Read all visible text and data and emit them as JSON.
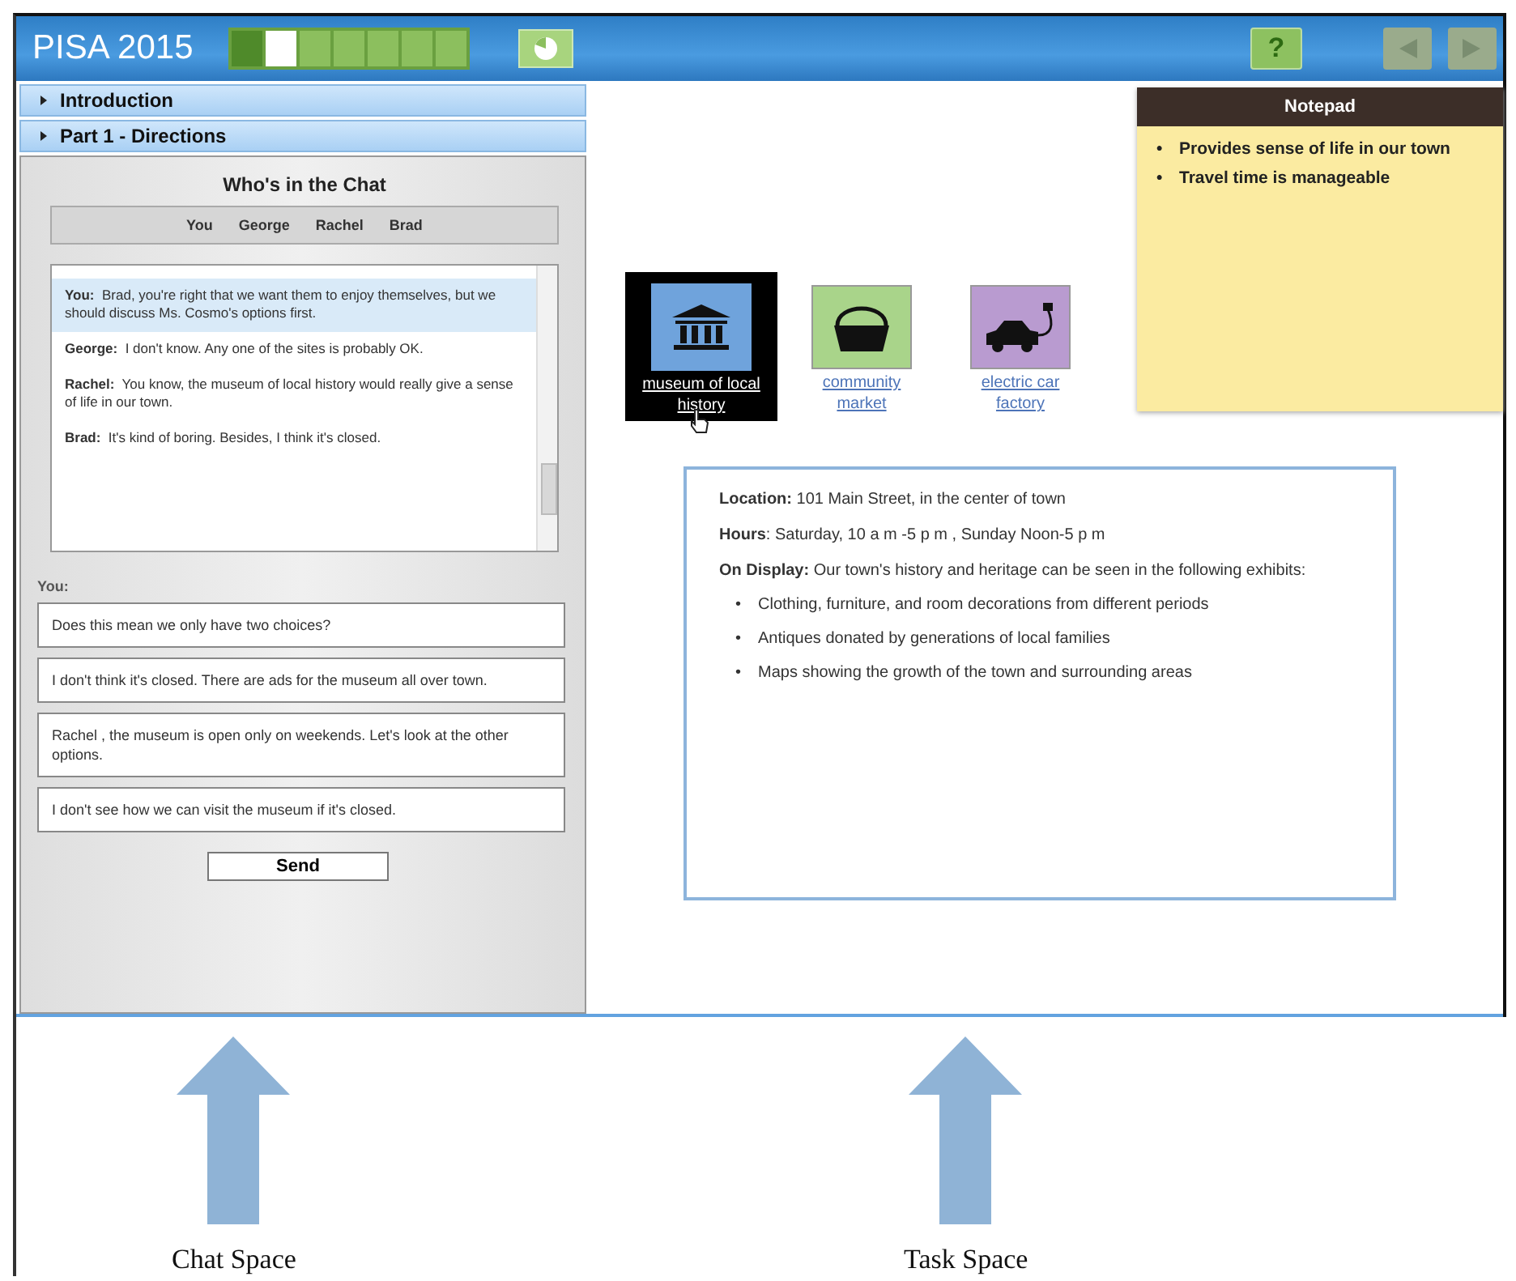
{
  "header": {
    "title": "PISA 2015",
    "progress": [
      {
        "kind": "done"
      },
      {
        "kind": "current"
      },
      {
        "kind": "todo"
      },
      {
        "kind": "todo"
      },
      {
        "kind": "todo"
      },
      {
        "kind": "todo"
      },
      {
        "kind": "todo"
      }
    ],
    "help_label": "?"
  },
  "sections": [
    {
      "label": "Introduction",
      "expanded": false
    },
    {
      "label": "Part 1 - Directions",
      "expanded": false
    }
  ],
  "chat": {
    "title": "Who's in the Chat",
    "participants": [
      "You",
      "George",
      "Rachel",
      "Brad"
    ],
    "messages": [
      {
        "speaker": "You:",
        "text": "Brad, you're right that we want them to enjoy themselves, but we should discuss Ms. Cosmo's options first.",
        "selected": true
      },
      {
        "speaker": "George:",
        "text": "I don't know. Any one of the sites is probably OK.",
        "selected": false
      },
      {
        "speaker": "Rachel:",
        "text": "You know, the museum of local history would really give a sense of life in our town.",
        "selected": false
      },
      {
        "speaker": "Brad:",
        "text": "It's kind of boring. Besides, I think it's closed.",
        "selected": false
      }
    ],
    "reply_label": "You:",
    "options": [
      "Does this mean we only have two choices?",
      "I don't think it's closed. There are ads for the museum all over town.",
      "Rachel , the museum is open only on weekends. Let's look at the other options.",
      "I don't see how we can visit the museum if it's closed."
    ],
    "send_label": "Send"
  },
  "sites": [
    {
      "kind": "museum",
      "label": "museum of local history",
      "selected": true
    },
    {
      "kind": "market",
      "label": "community market",
      "selected": false
    },
    {
      "kind": "car",
      "label": "electric car factory",
      "selected": false
    }
  ],
  "notepad": {
    "title": "Notepad",
    "bullet": "•",
    "items": [
      "Provides sense of life in our town",
      "Travel time is manageable"
    ]
  },
  "details": {
    "location": "**Location:** 101 Main Street, in the center of town",
    "hours": "**Hours**: Saturday, 10 a m -5 p m , Sunday Noon-5 p m",
    "display": "**On Display:** Our town's history and heritage can be seen in the following exhibits:",
    "bullet": "•",
    "exhibits": [
      "Clothing, furniture, and room decorations from different periods",
      "Antiques donated by generations of local families",
      "Maps showing the growth of the town and surrounding areas"
    ]
  },
  "captions": [
    "Chat Space",
    "Task Space"
  ]
}
